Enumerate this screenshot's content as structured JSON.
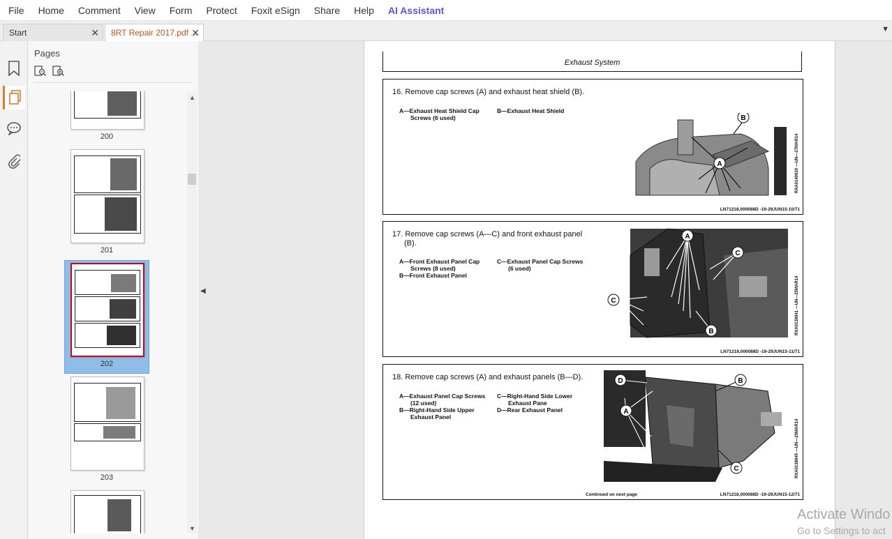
{
  "menu": {
    "items": [
      "File",
      "Home",
      "Comment",
      "View",
      "Form",
      "Protect",
      "Foxit eSign",
      "Share",
      "Help"
    ],
    "ai_assistant": "AI Assistant"
  },
  "tabs": {
    "start": "Start",
    "document": "8RT Repair 2017.pdf ...",
    "close_glyph": "✕"
  },
  "pages_panel": {
    "title": "Pages",
    "thumbnails": [
      {
        "page": "200"
      },
      {
        "page": "201"
      },
      {
        "page": "202",
        "selected": true
      },
      {
        "page": "203"
      }
    ]
  },
  "document": {
    "section_title": "Exhaust System",
    "steps": [
      {
        "title": "16. Remove cap screws (A) and exhaust heat shield (B).",
        "legend_left": [
          "A—Exhaust Heat Shield Cap",
          "Screws (6 used)"
        ],
        "legend_right": [
          "B—Exhaust Heat Shield"
        ],
        "image_id": "RXA0140620 —UN—27MAR14",
        "code": "LN71218,000088D -19-29JUN15-10/71",
        "callouts": [
          "A",
          "B"
        ]
      },
      {
        "title_line1": "17. Remove cap screws (A—C) and front exhaust panel",
        "title_line2": "(B).",
        "legend_left": [
          "A—Front Exhaust Panel Cap",
          "Screws (8 used)",
          "B—Front Exhaust Panel"
        ],
        "legend_right": [
          "C—Exhaust Panel Cap Screws",
          "(6 used)"
        ],
        "image_id": "RXA0139941 —UN—25MAR14",
        "code": "LN71218,000088D -19-29JUN15-11/71",
        "callouts": [
          "A",
          "B",
          "C"
        ]
      },
      {
        "title": "18. Remove cap screws (A) and exhaust panels (B—D).",
        "legend_left": [
          "A—Exhaust Panel Cap Screws",
          "(12 used)",
          "B—Right-Hand Side Upper",
          "Exhaust Panel"
        ],
        "legend_right": [
          "C—Right-Hand Side Lower",
          "Exhaust Pane",
          "D—Rear Exhaust Panel"
        ],
        "image_id": "RXA0139945 —UN—25MAR14",
        "continued": "Continued on next page",
        "code": "LN71218,000088D -19-29JUN15-12/71",
        "callouts": [
          "A",
          "B",
          "C",
          "D"
        ]
      }
    ]
  },
  "watermark": {
    "line1": "Activate Windo",
    "line2": "Go to Settings to act"
  },
  "colors": {
    "accent_tab": "#c8511b",
    "ai": "#6b4fd8",
    "selection": "#8fbde7",
    "selection_frame": "#d0021b"
  }
}
